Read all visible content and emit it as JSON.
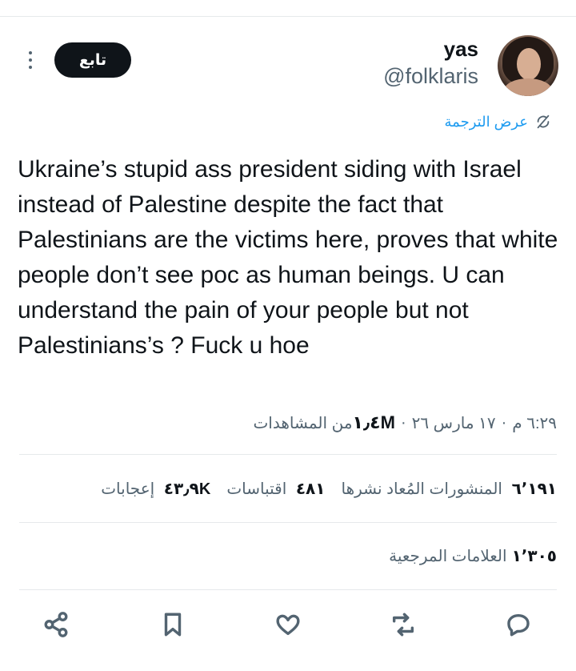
{
  "author": {
    "name": "yas",
    "handle": "@folklaris"
  },
  "follow_label": "تابع",
  "translate_label": "عرض الترجمة",
  "tweet_text": "Ukraine’s stupid ass president siding with Israel instead of Palestine despite the fact that Palestinians are the victims here, proves that white people don’t see poc as human beings. U can understand the pain of your people but not Palestinians’s ? Fuck u hoe",
  "meta": {
    "time": "٦:٢٩ م",
    "date": "١٧ مارس ٢٦",
    "separator": "·",
    "views_count": "١٫٤M",
    "views_label": "من المشاهدات"
  },
  "stats": {
    "reposts_count": "٦٬١٩١",
    "reposts_label": "المنشورات المُعاد نشرها",
    "quotes_count": "٤٨١",
    "quotes_label": "اقتباسات",
    "likes_count": "٤٣٫٩K",
    "likes_label": "إعجابات"
  },
  "bookmarks": {
    "count": "١٬٣٠٥",
    "label": "العلامات المرجعية"
  },
  "icons": {
    "translate": "translate-icon",
    "more": "more-vertical-icon",
    "share": "share-icon",
    "bookmark": "bookmark-icon",
    "like": "heart-icon",
    "repost": "repost-icon",
    "reply": "reply-icon"
  },
  "colors": {
    "accent": "#1d9bf0",
    "text_primary": "#0f1419",
    "text_secondary": "#536471",
    "divider": "#e6e9eb"
  }
}
